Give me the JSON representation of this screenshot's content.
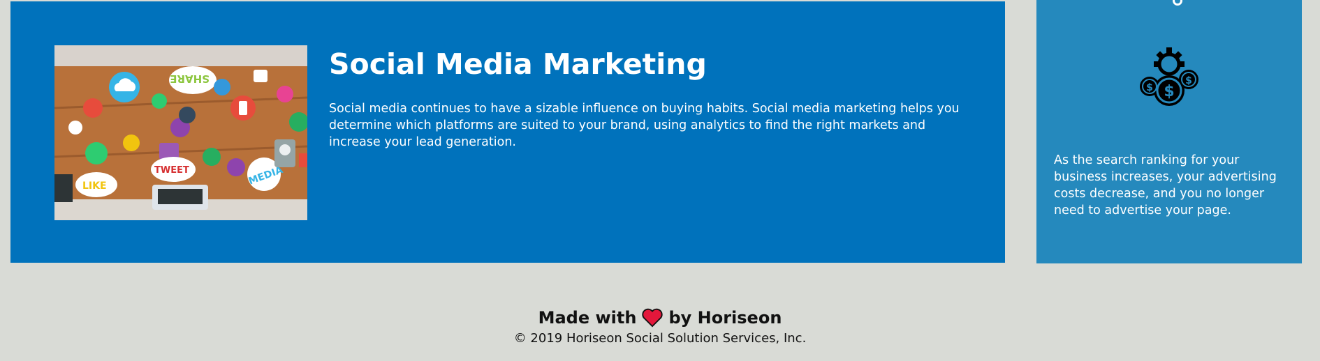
{
  "main_article": {
    "title": "Social Media Marketing",
    "body": "Social media continues to have a sizable influence on buying habits. Social media marketing helps you determine which platforms are suited to your brand, using analytics to find the right markets and increase your lead generation.",
    "image": {
      "icon": "social-media-photo",
      "labels": [
        "SHARE",
        "TWEET",
        "LIKE",
        "MEDIA"
      ]
    }
  },
  "side_card": {
    "icon": "cost-gears-dollar-icon",
    "body": "As the search ranking for your business increases, your advertising costs decrease, and you no longer need to advertise your page."
  },
  "footer": {
    "made_with": "Made with",
    "by": "by Horiseon",
    "heart_icon": "heart-icon",
    "copyright": "© 2019 Horiseon Social Solution Services, Inc."
  },
  "colors": {
    "background": "#d9dbd6",
    "article_blue": "#0072bc",
    "side_blue": "#2589bd",
    "heart_red": "#e3173b"
  }
}
